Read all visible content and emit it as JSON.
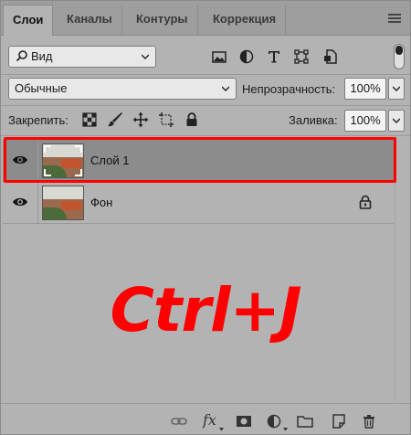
{
  "tabs": [
    {
      "label": "Слои",
      "active": true
    },
    {
      "label": "Каналы",
      "active": false
    },
    {
      "label": "Контуры",
      "active": false
    },
    {
      "label": "Коррекция",
      "active": false
    }
  ],
  "filter": {
    "select_value": "Вид",
    "icons": [
      "image-filter-icon",
      "adjustment-filter-icon",
      "type-filter-icon",
      "shape-filter-icon",
      "smart-object-filter-icon"
    ]
  },
  "blend": {
    "mode": "Обычные",
    "opacity_label": "Непрозрачность:",
    "opacity_value": "100%"
  },
  "lock": {
    "label": "Закрепить:",
    "fill_label": "Заливка:",
    "fill_value": "100%"
  },
  "layers": [
    {
      "name": "Слой 1",
      "selected": true,
      "visible": true,
      "locked": false
    },
    {
      "name": "Фон",
      "selected": false,
      "visible": true,
      "locked": true
    }
  ],
  "overlay": {
    "text": "Ctrl+J",
    "color": "#ff0000"
  },
  "bottom_toolbar": {
    "fx_label": "fx",
    "icons": [
      "link-layers-icon",
      "fx-icon",
      "add-mask-icon",
      "new-adjustment-icon",
      "new-group-icon",
      "new-layer-icon",
      "delete-layer-icon"
    ]
  },
  "colors": {
    "panel_bg": "#b3b3b3",
    "selected_row": "#8c8c8c",
    "highlight": "#ff0000"
  }
}
